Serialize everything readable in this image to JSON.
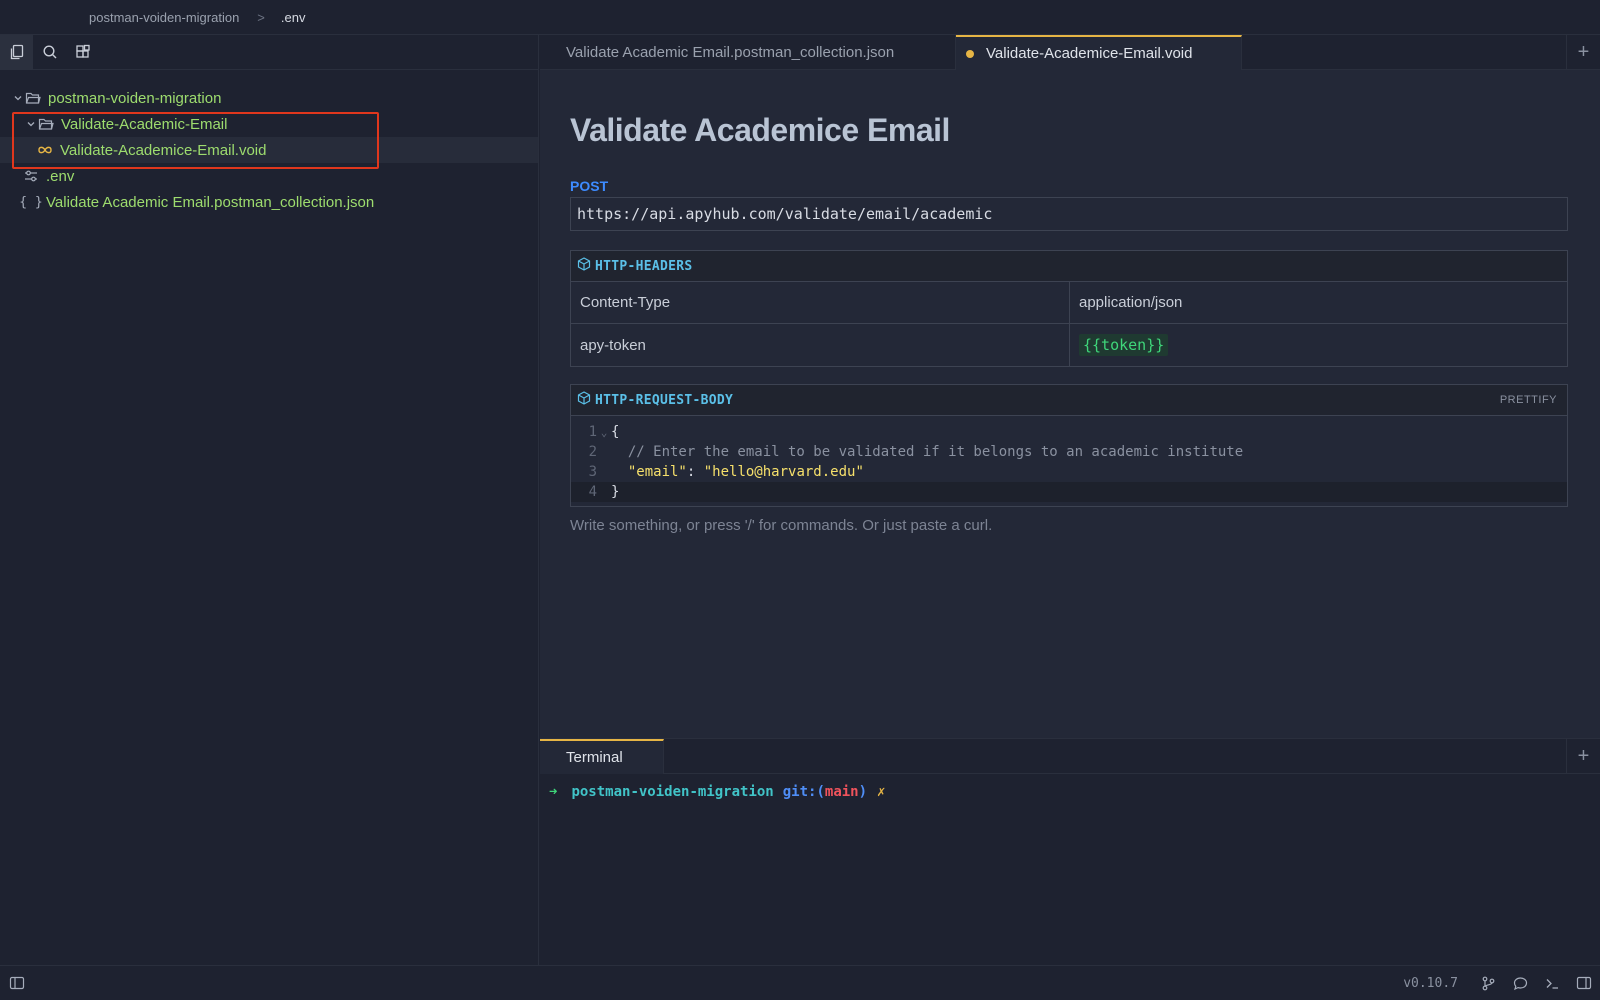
{
  "breadcrumb": {
    "project": "postman-voiden-migration",
    "separator": ">",
    "file": ".env"
  },
  "sidebar": {
    "toolbar": [
      {
        "name": "files-icon"
      },
      {
        "name": "search-icon"
      },
      {
        "name": "extensions-icon"
      }
    ],
    "tree": [
      {
        "label": "postman-voiden-migration",
        "type": "folder",
        "expanded": true,
        "depth": 0
      },
      {
        "label": "Validate-Academic-Email",
        "type": "folder",
        "expanded": true,
        "depth": 1
      },
      {
        "label": "Validate-Academice-Email.void",
        "type": "void-file",
        "depth": 2,
        "selected": true
      },
      {
        "label": ".env",
        "type": "env-file",
        "depth": 1
      },
      {
        "label": "Validate Academic Email.postman_collection.json",
        "type": "json-file",
        "icon_text": "{ }",
        "depth": 1
      }
    ]
  },
  "tabs": [
    {
      "label": "Validate Academic Email.postman_collection.json",
      "active": false
    },
    {
      "label": "Validate-Academice-Email.void",
      "active": true,
      "unsaved": true
    }
  ],
  "tab_add": "+",
  "editor": {
    "title": "Validate Academice Email",
    "method": "POST",
    "url": "https://api.apyhub.com/validate/email/academic",
    "headers_label": "HTTP-HEADERS",
    "headers": [
      {
        "key": "Content-Type",
        "value": "application/json"
      },
      {
        "key": "apy-token",
        "value": "{{token}}"
      }
    ],
    "body_label": "HTTP-REQUEST-BODY",
    "prettify_label": "PRETTIFY",
    "body_lines": [
      {
        "num": "1",
        "text": "{"
      },
      {
        "num": "2",
        "text": "  // Enter the email to be validated if it belongs to an academic institute"
      },
      {
        "num": "3",
        "key": "\"email\"",
        "colon": ": ",
        "value": "\"hello@harvard.edu\""
      },
      {
        "num": "4",
        "text": "}"
      }
    ],
    "placeholder": "Write something, or press '/' for commands. Or just paste a curl."
  },
  "terminal": {
    "tab_label": "Terminal",
    "prompt_arrow": "➜",
    "prompt_dir": "postman-voiden-migration",
    "prompt_git": "git:(",
    "prompt_branch": "main",
    "prompt_git_close": ")",
    "prompt_dirty": "✗"
  },
  "statusbar": {
    "version": "v0.10.7"
  },
  "colors": {
    "accent": "#e6b545",
    "tree_text": "#9ddc6e",
    "method": "#3d8bff",
    "highlight": "#e0371d"
  }
}
